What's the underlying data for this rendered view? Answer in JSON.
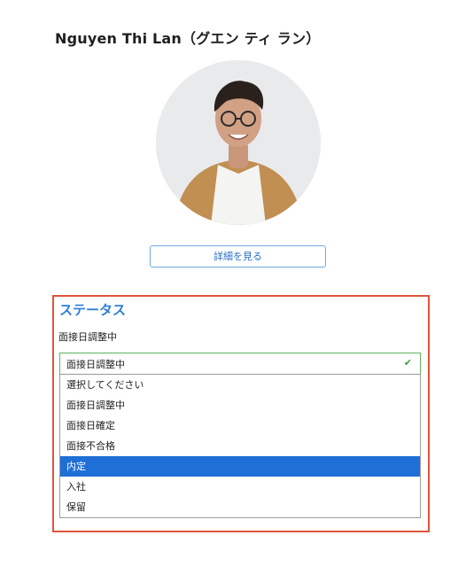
{
  "profile": {
    "name": "Nguyen Thi Lan（グエン ティ ラン）",
    "detail_button": "詳細を見る"
  },
  "status": {
    "title": "ステータス",
    "current": "面接日調整中",
    "select_value": "面接日調整中",
    "options": [
      {
        "label": "選択してください"
      },
      {
        "label": "面接日調整中"
      },
      {
        "label": "面接日確定"
      },
      {
        "label": "面接不合格"
      },
      {
        "label": "内定",
        "highlighted": true
      },
      {
        "label": "入社"
      },
      {
        "label": "保留"
      }
    ]
  },
  "colors": {
    "accent_blue": "#2d7ed8",
    "highlight": "#1f6fd6",
    "annotation_border": "#e0553b",
    "valid_green": "#3aa03a"
  }
}
